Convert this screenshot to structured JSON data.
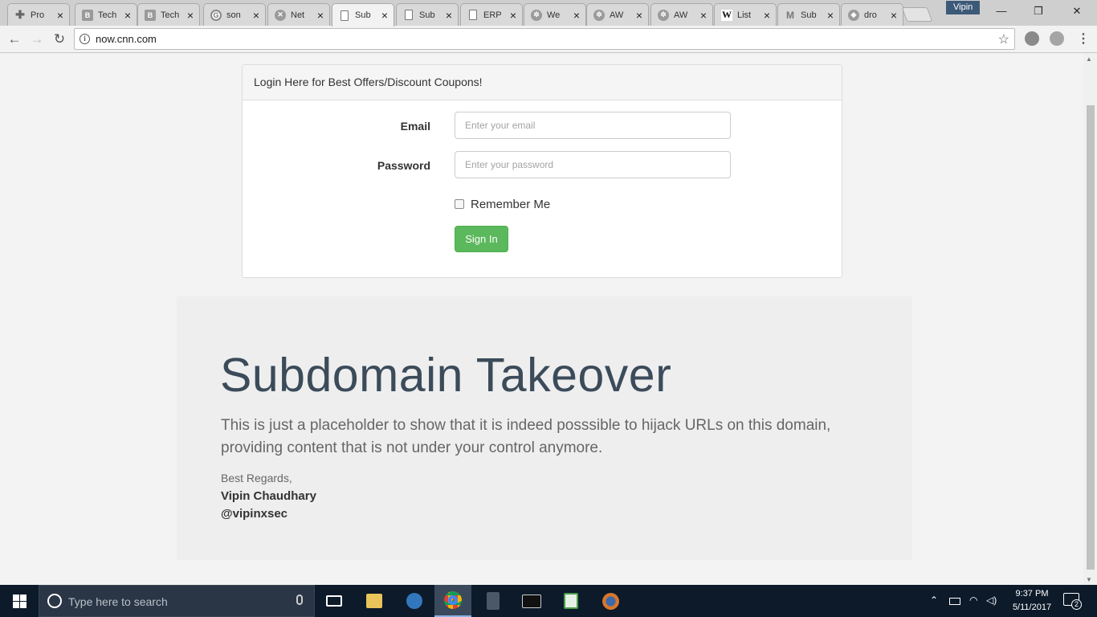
{
  "browser": {
    "tabs": [
      {
        "title": "Pro",
        "icon": "plus-icon"
      },
      {
        "title": "Tech",
        "icon": "blogger-icon"
      },
      {
        "title": "Tech",
        "icon": "blogger-icon"
      },
      {
        "title": "son",
        "icon": "google-icon"
      },
      {
        "title": "Net",
        "icon": "x-icon"
      },
      {
        "title": "Sub",
        "icon": "page-icon",
        "active": true
      },
      {
        "title": "Sub",
        "icon": "page-icon"
      },
      {
        "title": "ERP",
        "icon": "page-icon"
      },
      {
        "title": "We",
        "icon": "gear-icon"
      },
      {
        "title": "AW",
        "icon": "gear-icon"
      },
      {
        "title": "AW",
        "icon": "gear-icon"
      },
      {
        "title": "List",
        "icon": "wikipedia-icon"
      },
      {
        "title": "Sub",
        "icon": "gmail-icon"
      },
      {
        "title": "dro",
        "icon": "dropbox-icon"
      }
    ],
    "profile_name": "Vipin",
    "url": "now.cnn.com",
    "accent": "#3c5a78"
  },
  "login": {
    "heading": "Login Here for Best Offers/Discount Coupons!",
    "email_label": "Email",
    "email_placeholder": "Enter your email",
    "password_label": "Password",
    "password_placeholder": "Enter your password",
    "remember_label": "Remember Me",
    "remember_checked": false,
    "signin_label": "Sign In",
    "button_color": "#5cb85c"
  },
  "message": {
    "title": "Subdomain Takeover",
    "lead": "This is just a placeholder to show that it is indeed posssible to hijack URLs on this domain, providing content that is not under your control anymore.",
    "regards": "Best Regards,",
    "author": "Vipin Chaudhary",
    "handle": "@vipinxsec"
  },
  "taskbar": {
    "search_placeholder": "Type here to search",
    "apps": [
      "task-view-icon",
      "file-explorer-icon",
      "edge-icon",
      "chrome-icon",
      "app-icon",
      "terminal-icon",
      "notepad-icon",
      "firefox-icon"
    ],
    "time": "9:37 PM",
    "date": "5/11/2017",
    "notification_count": "2"
  }
}
